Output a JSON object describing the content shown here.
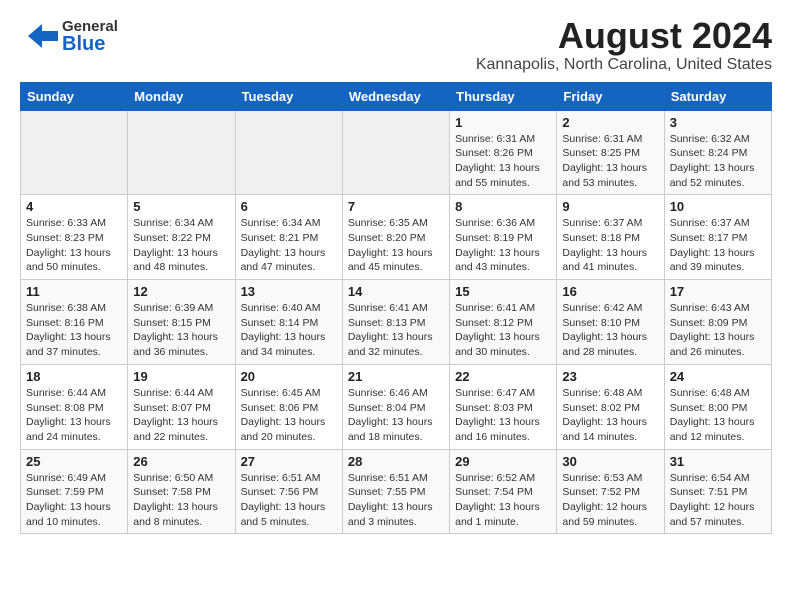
{
  "header": {
    "logo_general": "General",
    "logo_blue": "Blue",
    "title": "August 2024",
    "subtitle": "Kannapolis, North Carolina, United States"
  },
  "calendar": {
    "weekdays": [
      "Sunday",
      "Monday",
      "Tuesday",
      "Wednesday",
      "Thursday",
      "Friday",
      "Saturday"
    ],
    "weeks": [
      [
        {
          "day": "",
          "info": ""
        },
        {
          "day": "",
          "info": ""
        },
        {
          "day": "",
          "info": ""
        },
        {
          "day": "",
          "info": ""
        },
        {
          "day": "1",
          "info": "Sunrise: 6:31 AM\nSunset: 8:26 PM\nDaylight: 13 hours and 55 minutes."
        },
        {
          "day": "2",
          "info": "Sunrise: 6:31 AM\nSunset: 8:25 PM\nDaylight: 13 hours and 53 minutes."
        },
        {
          "day": "3",
          "info": "Sunrise: 6:32 AM\nSunset: 8:24 PM\nDaylight: 13 hours and 52 minutes."
        }
      ],
      [
        {
          "day": "4",
          "info": "Sunrise: 6:33 AM\nSunset: 8:23 PM\nDaylight: 13 hours and 50 minutes."
        },
        {
          "day": "5",
          "info": "Sunrise: 6:34 AM\nSunset: 8:22 PM\nDaylight: 13 hours and 48 minutes."
        },
        {
          "day": "6",
          "info": "Sunrise: 6:34 AM\nSunset: 8:21 PM\nDaylight: 13 hours and 47 minutes."
        },
        {
          "day": "7",
          "info": "Sunrise: 6:35 AM\nSunset: 8:20 PM\nDaylight: 13 hours and 45 minutes."
        },
        {
          "day": "8",
          "info": "Sunrise: 6:36 AM\nSunset: 8:19 PM\nDaylight: 13 hours and 43 minutes."
        },
        {
          "day": "9",
          "info": "Sunrise: 6:37 AM\nSunset: 8:18 PM\nDaylight: 13 hours and 41 minutes."
        },
        {
          "day": "10",
          "info": "Sunrise: 6:37 AM\nSunset: 8:17 PM\nDaylight: 13 hours and 39 minutes."
        }
      ],
      [
        {
          "day": "11",
          "info": "Sunrise: 6:38 AM\nSunset: 8:16 PM\nDaylight: 13 hours and 37 minutes."
        },
        {
          "day": "12",
          "info": "Sunrise: 6:39 AM\nSunset: 8:15 PM\nDaylight: 13 hours and 36 minutes."
        },
        {
          "day": "13",
          "info": "Sunrise: 6:40 AM\nSunset: 8:14 PM\nDaylight: 13 hours and 34 minutes."
        },
        {
          "day": "14",
          "info": "Sunrise: 6:41 AM\nSunset: 8:13 PM\nDaylight: 13 hours and 32 minutes."
        },
        {
          "day": "15",
          "info": "Sunrise: 6:41 AM\nSunset: 8:12 PM\nDaylight: 13 hours and 30 minutes."
        },
        {
          "day": "16",
          "info": "Sunrise: 6:42 AM\nSunset: 8:10 PM\nDaylight: 13 hours and 28 minutes."
        },
        {
          "day": "17",
          "info": "Sunrise: 6:43 AM\nSunset: 8:09 PM\nDaylight: 13 hours and 26 minutes."
        }
      ],
      [
        {
          "day": "18",
          "info": "Sunrise: 6:44 AM\nSunset: 8:08 PM\nDaylight: 13 hours and 24 minutes."
        },
        {
          "day": "19",
          "info": "Sunrise: 6:44 AM\nSunset: 8:07 PM\nDaylight: 13 hours and 22 minutes."
        },
        {
          "day": "20",
          "info": "Sunrise: 6:45 AM\nSunset: 8:06 PM\nDaylight: 13 hours and 20 minutes."
        },
        {
          "day": "21",
          "info": "Sunrise: 6:46 AM\nSunset: 8:04 PM\nDaylight: 13 hours and 18 minutes."
        },
        {
          "day": "22",
          "info": "Sunrise: 6:47 AM\nSunset: 8:03 PM\nDaylight: 13 hours and 16 minutes."
        },
        {
          "day": "23",
          "info": "Sunrise: 6:48 AM\nSunset: 8:02 PM\nDaylight: 13 hours and 14 minutes."
        },
        {
          "day": "24",
          "info": "Sunrise: 6:48 AM\nSunset: 8:00 PM\nDaylight: 13 hours and 12 minutes."
        }
      ],
      [
        {
          "day": "25",
          "info": "Sunrise: 6:49 AM\nSunset: 7:59 PM\nDaylight: 13 hours and 10 minutes."
        },
        {
          "day": "26",
          "info": "Sunrise: 6:50 AM\nSunset: 7:58 PM\nDaylight: 13 hours and 8 minutes."
        },
        {
          "day": "27",
          "info": "Sunrise: 6:51 AM\nSunset: 7:56 PM\nDaylight: 13 hours and 5 minutes."
        },
        {
          "day": "28",
          "info": "Sunrise: 6:51 AM\nSunset: 7:55 PM\nDaylight: 13 hours and 3 minutes."
        },
        {
          "day": "29",
          "info": "Sunrise: 6:52 AM\nSunset: 7:54 PM\nDaylight: 13 hours and 1 minute."
        },
        {
          "day": "30",
          "info": "Sunrise: 6:53 AM\nSunset: 7:52 PM\nDaylight: 12 hours and 59 minutes."
        },
        {
          "day": "31",
          "info": "Sunrise: 6:54 AM\nSunset: 7:51 PM\nDaylight: 12 hours and 57 minutes."
        }
      ]
    ]
  }
}
